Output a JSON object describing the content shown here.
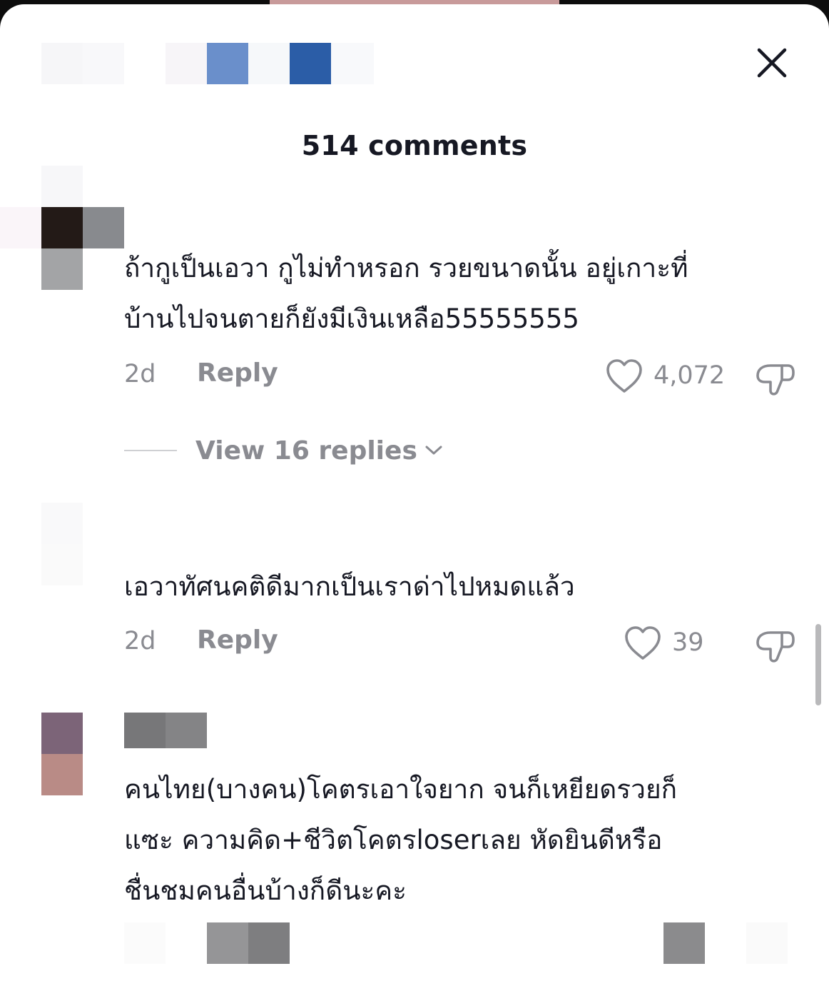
{
  "header": {
    "title": "514 comments",
    "close_icon": "close-icon"
  },
  "comments": [
    {
      "text_lines": [
        "ถ้ากูเป็นเอวา กูไม่ทำหรอก รวยขนาดนั้น อยู่เกาะที่",
        "บ้านไปจนตายก็ยังมีเงินเหลือ55555555"
      ],
      "time": "2d",
      "reply_label": "Reply",
      "likes": "4,072",
      "view_replies": "View 16 replies"
    },
    {
      "text_lines": [
        "เอวาทัศนคติดีมากเป็นเราด่าไปหมดแล้ว"
      ],
      "time": "2d",
      "reply_label": "Reply",
      "likes": "39"
    },
    {
      "text_lines": [
        "คนไทย(บางคน)โคตรเอาใจยาก จนก็เหยียดรวยก็",
        "แซะ ความคิด+ชีวิตโคตรloserเลย หัดยินดีหรือ",
        "ชื่นชมคนอื่นบ้างก็ดีนะคะ"
      ]
    }
  ],
  "colors": {
    "text": "#161823",
    "muted": "#8a8b91",
    "background": "#ffffff"
  },
  "icons": [
    "close-icon",
    "heart-icon",
    "dislike-icon",
    "chevron-down-icon"
  ]
}
